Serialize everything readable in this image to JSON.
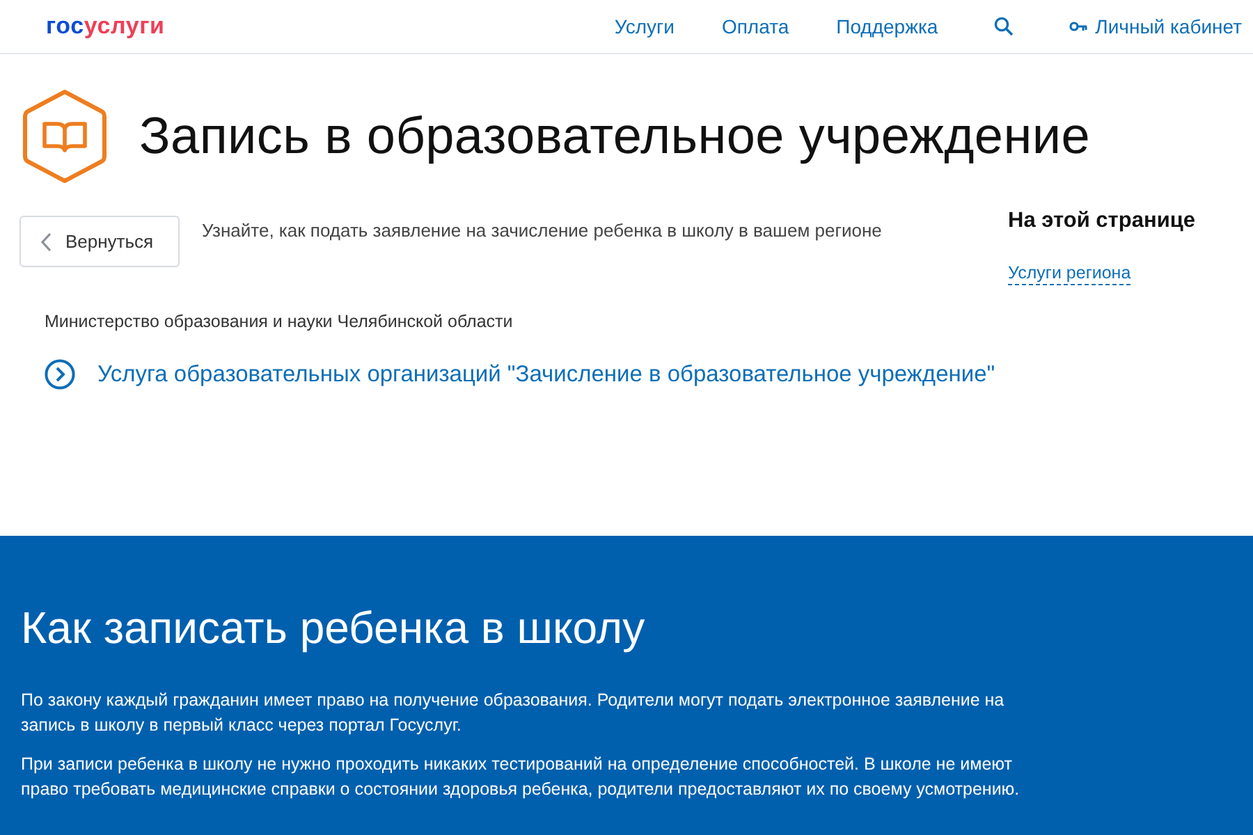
{
  "header": {
    "logo": {
      "part_1": "гос",
      "part_2": "услуги"
    },
    "nav": [
      "Услуги",
      "Оплата",
      "Поддержка"
    ],
    "account": "Личный кабинет"
  },
  "title": "Запись в образовательное учреждение",
  "back_button": "Вернуться",
  "intro": "Узнайте, как подать заявление на зачисление ребенка в школу в вашем регионе",
  "on_this_page": {
    "heading": "На этой странице",
    "links": [
      "Услуги региона"
    ]
  },
  "organization": "Министерство образования и науки Челябинской области",
  "service_link": "Услуга образовательных организаций \"Зачисление в образовательное учреждение\"",
  "info": {
    "heading": "Как записать ребенка в школу",
    "paragraphs": [
      "По закону каждый гражданин имеет право на получение образования. Родители могут подать электронное заявление на запись в школу в первый класс через портал Госуслуг.",
      "При записи ребенка в школу не нужно проходить никаких тестирований на определение способностей. В школе не имеют право требовать медицинские справки о состоянии здоровья ребенка, родители предоставляют их по своему усмотрению."
    ]
  }
}
